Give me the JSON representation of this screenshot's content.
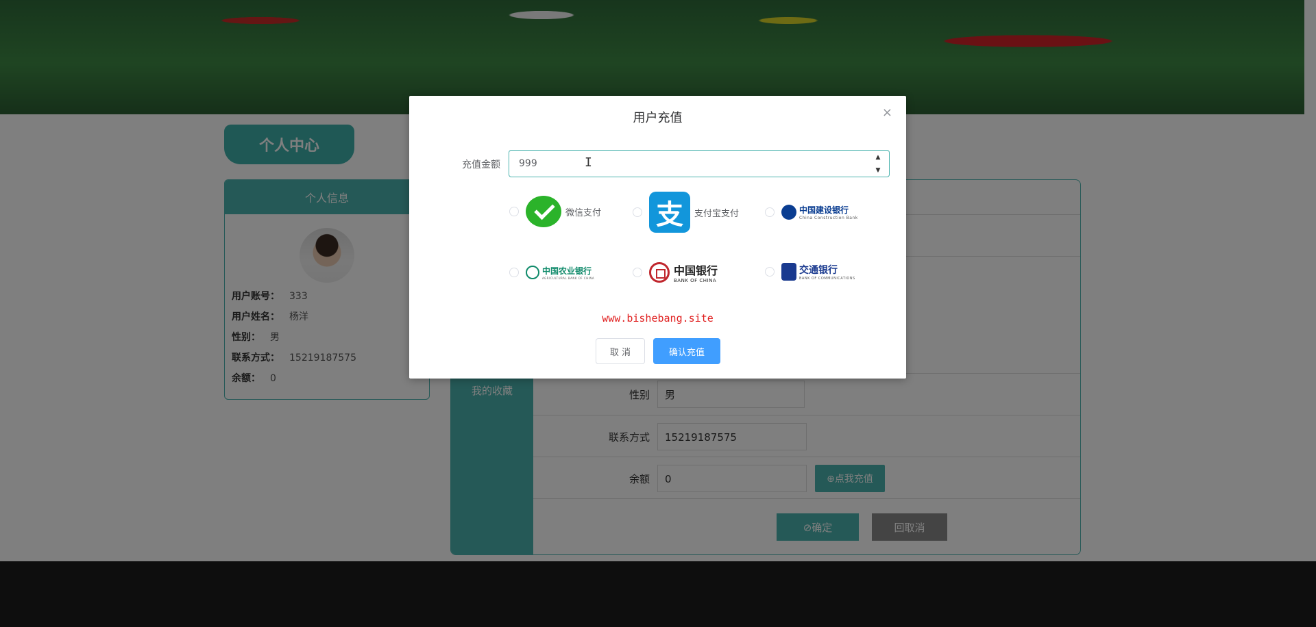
{
  "profile_tab": "个人中心",
  "info_card": {
    "header": "个人信息",
    "rows": [
      {
        "key": "用户账号：",
        "value": "333"
      },
      {
        "key": "用户姓名：",
        "value": "杨洋"
      },
      {
        "key": "性别：",
        "value": "男"
      },
      {
        "key": "联系方式：",
        "value": "15219187575"
      },
      {
        "key": "余额：",
        "value": "0"
      }
    ]
  },
  "side_menu": {
    "favorites": "我的收藏"
  },
  "form": {
    "gender_label": "性别",
    "gender_value": "男",
    "phone_label": "联系方式",
    "phone_value": "15219187575",
    "balance_label": "余额",
    "balance_value": "0",
    "recharge_button": "⊕点我充值",
    "confirm_button": "⊘确定",
    "cancel_button": "回取消"
  },
  "modal": {
    "title": "用户充值",
    "close": "×",
    "amount_label": "充值金额",
    "amount_value": "999",
    "stepper_up": "▲",
    "stepper_down": "▼",
    "payment_options": [
      {
        "label": "微信支付",
        "icon": "wechat-pay-logo"
      },
      {
        "label": "支付宝支付",
        "icon": "alipay-logo",
        "glyph": "支"
      },
      {
        "label": "中国建设银行",
        "icon": "ccb-logo",
        "sub": "China Construction Bank"
      },
      {
        "label": "中国农业银行",
        "icon": "abc-logo",
        "sub": "AGRICULTURAL BANK OF CHINA"
      },
      {
        "label": "中国银行",
        "icon": "boc-logo",
        "sub": "BANK OF CHINA"
      },
      {
        "label": "交通银行",
        "icon": "bocom-logo",
        "sub": "BANK OF COMMUNICATIONS"
      }
    ],
    "watermark": "www.bishebang.site",
    "cancel_button": "取 消",
    "confirm_button": "确认充值"
  },
  "colors": {
    "teal": "#4bb3ae",
    "primary": "#409eff",
    "watermark": "#e02020",
    "footer": "#1d1d1d"
  }
}
